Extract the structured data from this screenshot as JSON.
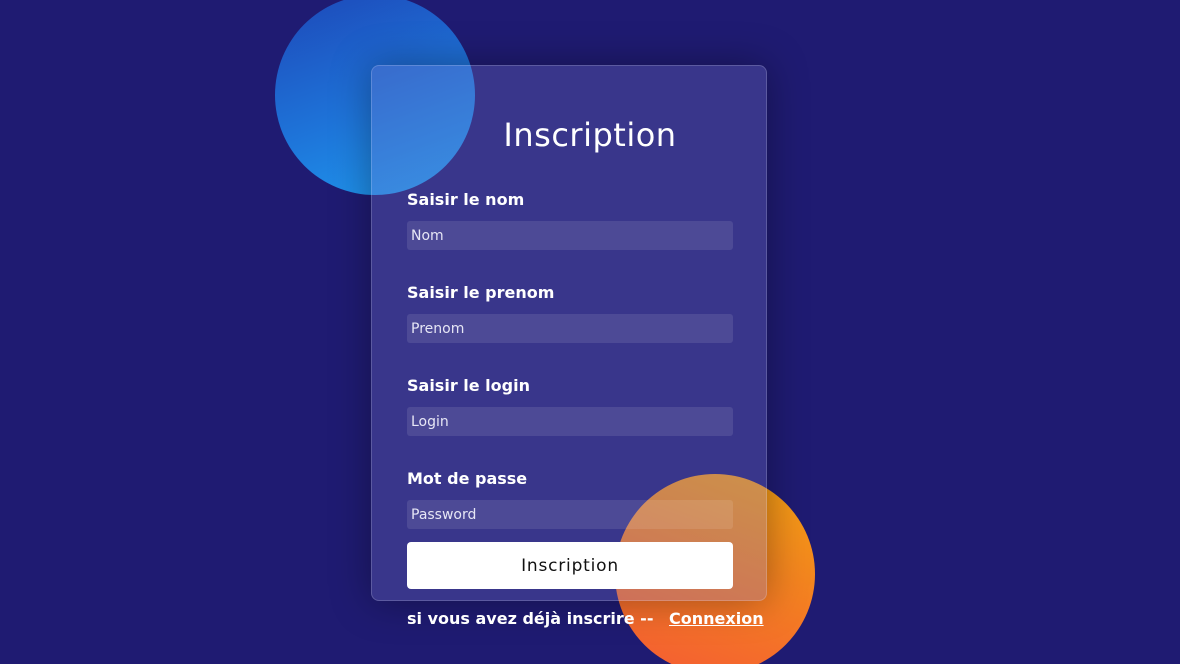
{
  "colors": {
    "background": "#1f1b72",
    "circle_top": "#1e74d9",
    "circle_bottom": "#f47a24",
    "button": "#ffffff"
  },
  "form": {
    "title": "Inscription",
    "fields": [
      {
        "label": "Saisir le nom",
        "placeholder": "Nom",
        "value": ""
      },
      {
        "label": "Saisir le prenom",
        "placeholder": "Prenom",
        "value": ""
      },
      {
        "label": "Saisir le login",
        "placeholder": "Login",
        "value": ""
      },
      {
        "label": "Mot de passe",
        "placeholder": "Password",
        "value": ""
      }
    ],
    "submit_label": "Inscription"
  },
  "footer": {
    "text": "si vous avez déjà inscrire --",
    "link_label": "Connexion"
  }
}
